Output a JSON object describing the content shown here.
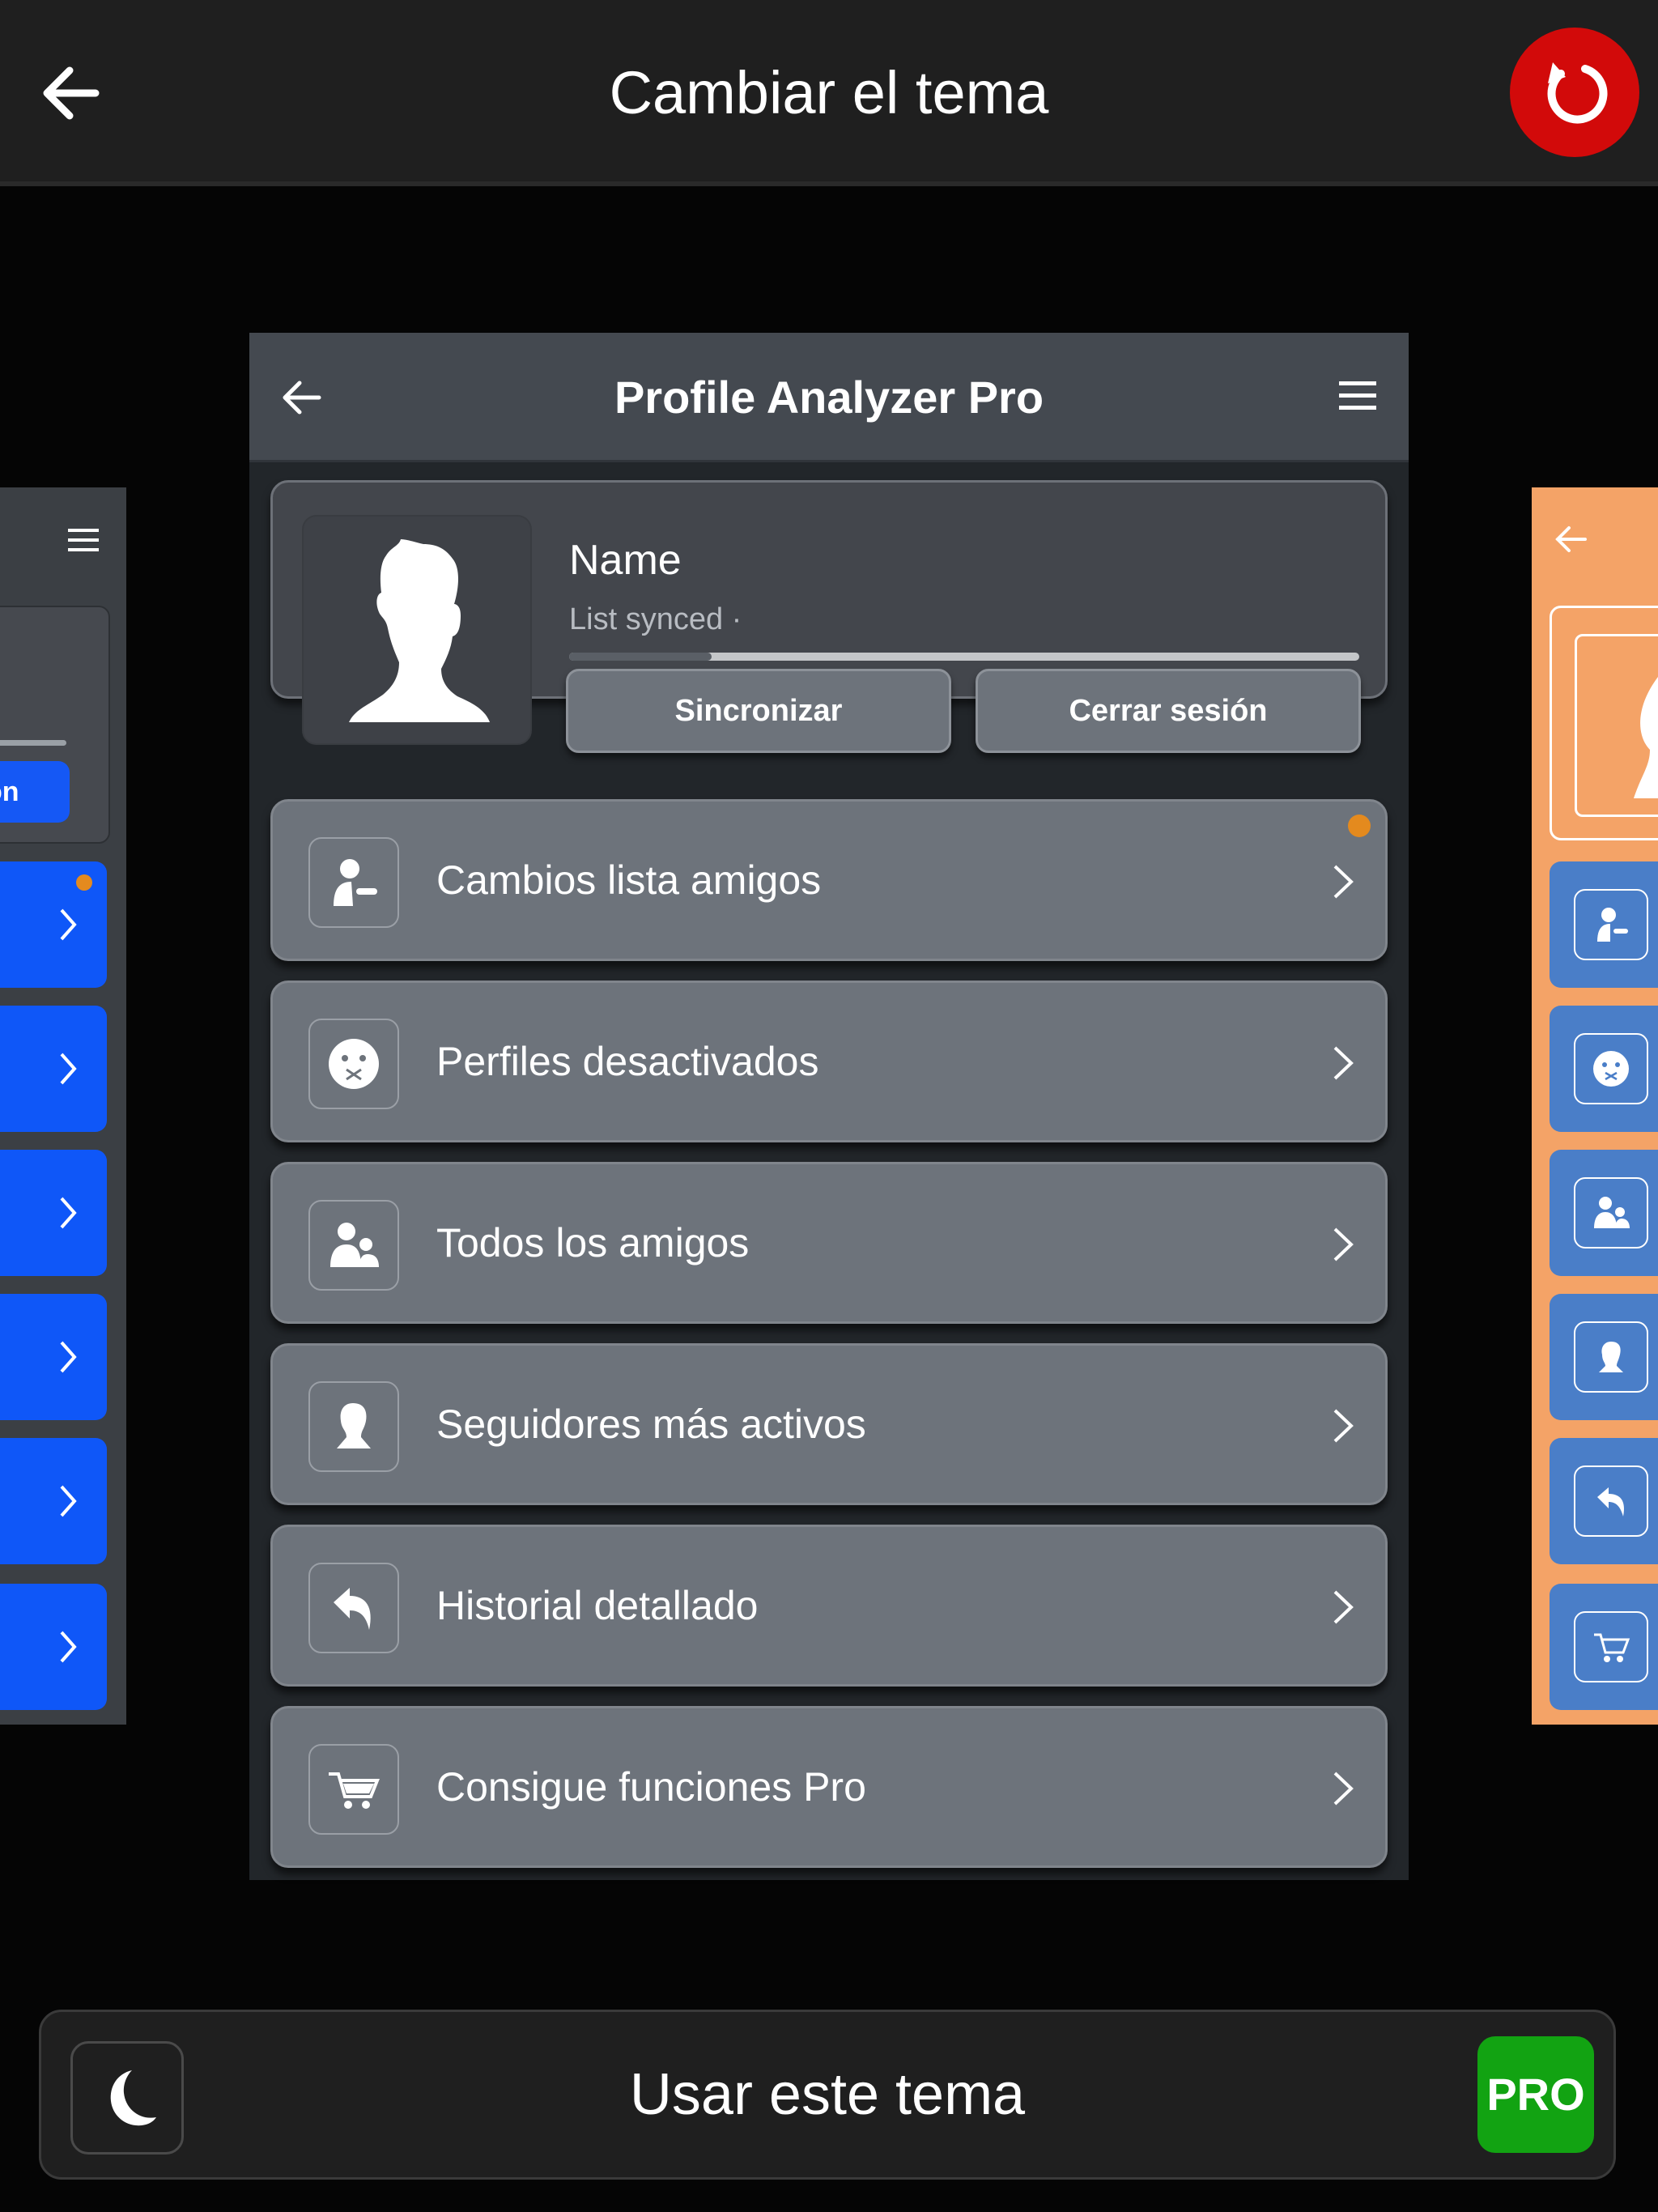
{
  "topbar": {
    "title": "Cambiar el tema"
  },
  "preview": {
    "app_title": "Profile Analyzer Pro",
    "profile": {
      "name": "Name",
      "status": "List synced ·",
      "sync_progress": 0.18,
      "sync_button": "Sincronizar",
      "logout_button": "Cerrar sesión"
    },
    "menu_items": [
      {
        "label": "Cambios lista amigos",
        "icon": "friend-changes-icon",
        "has_badge": true
      },
      {
        "label": "Perfiles desactivados",
        "icon": "deactivated-face-icon",
        "has_badge": false
      },
      {
        "label": "Todos los amigos",
        "icon": "friends-group-icon",
        "has_badge": false
      },
      {
        "label": "Seguidores más activos",
        "icon": "active-follower-icon",
        "has_badge": false
      },
      {
        "label": "Historial detallado",
        "icon": "history-reply-icon",
        "has_badge": false
      },
      {
        "label": "Consigue funciones Pro",
        "icon": "cart-icon",
        "has_badge": false
      }
    ]
  },
  "left_theme": {
    "button_partial_text": "on",
    "accent": "#0f57f8"
  },
  "right_theme": {
    "accent": "#f4a367",
    "item_color": "#4a7ec8"
  },
  "bottombar": {
    "label": "Usar este tema",
    "pro_badge": "PRO"
  },
  "colors": {
    "reset": "#d20a0a",
    "pro": "#12a312",
    "badge_dot": "#e48a1e"
  }
}
